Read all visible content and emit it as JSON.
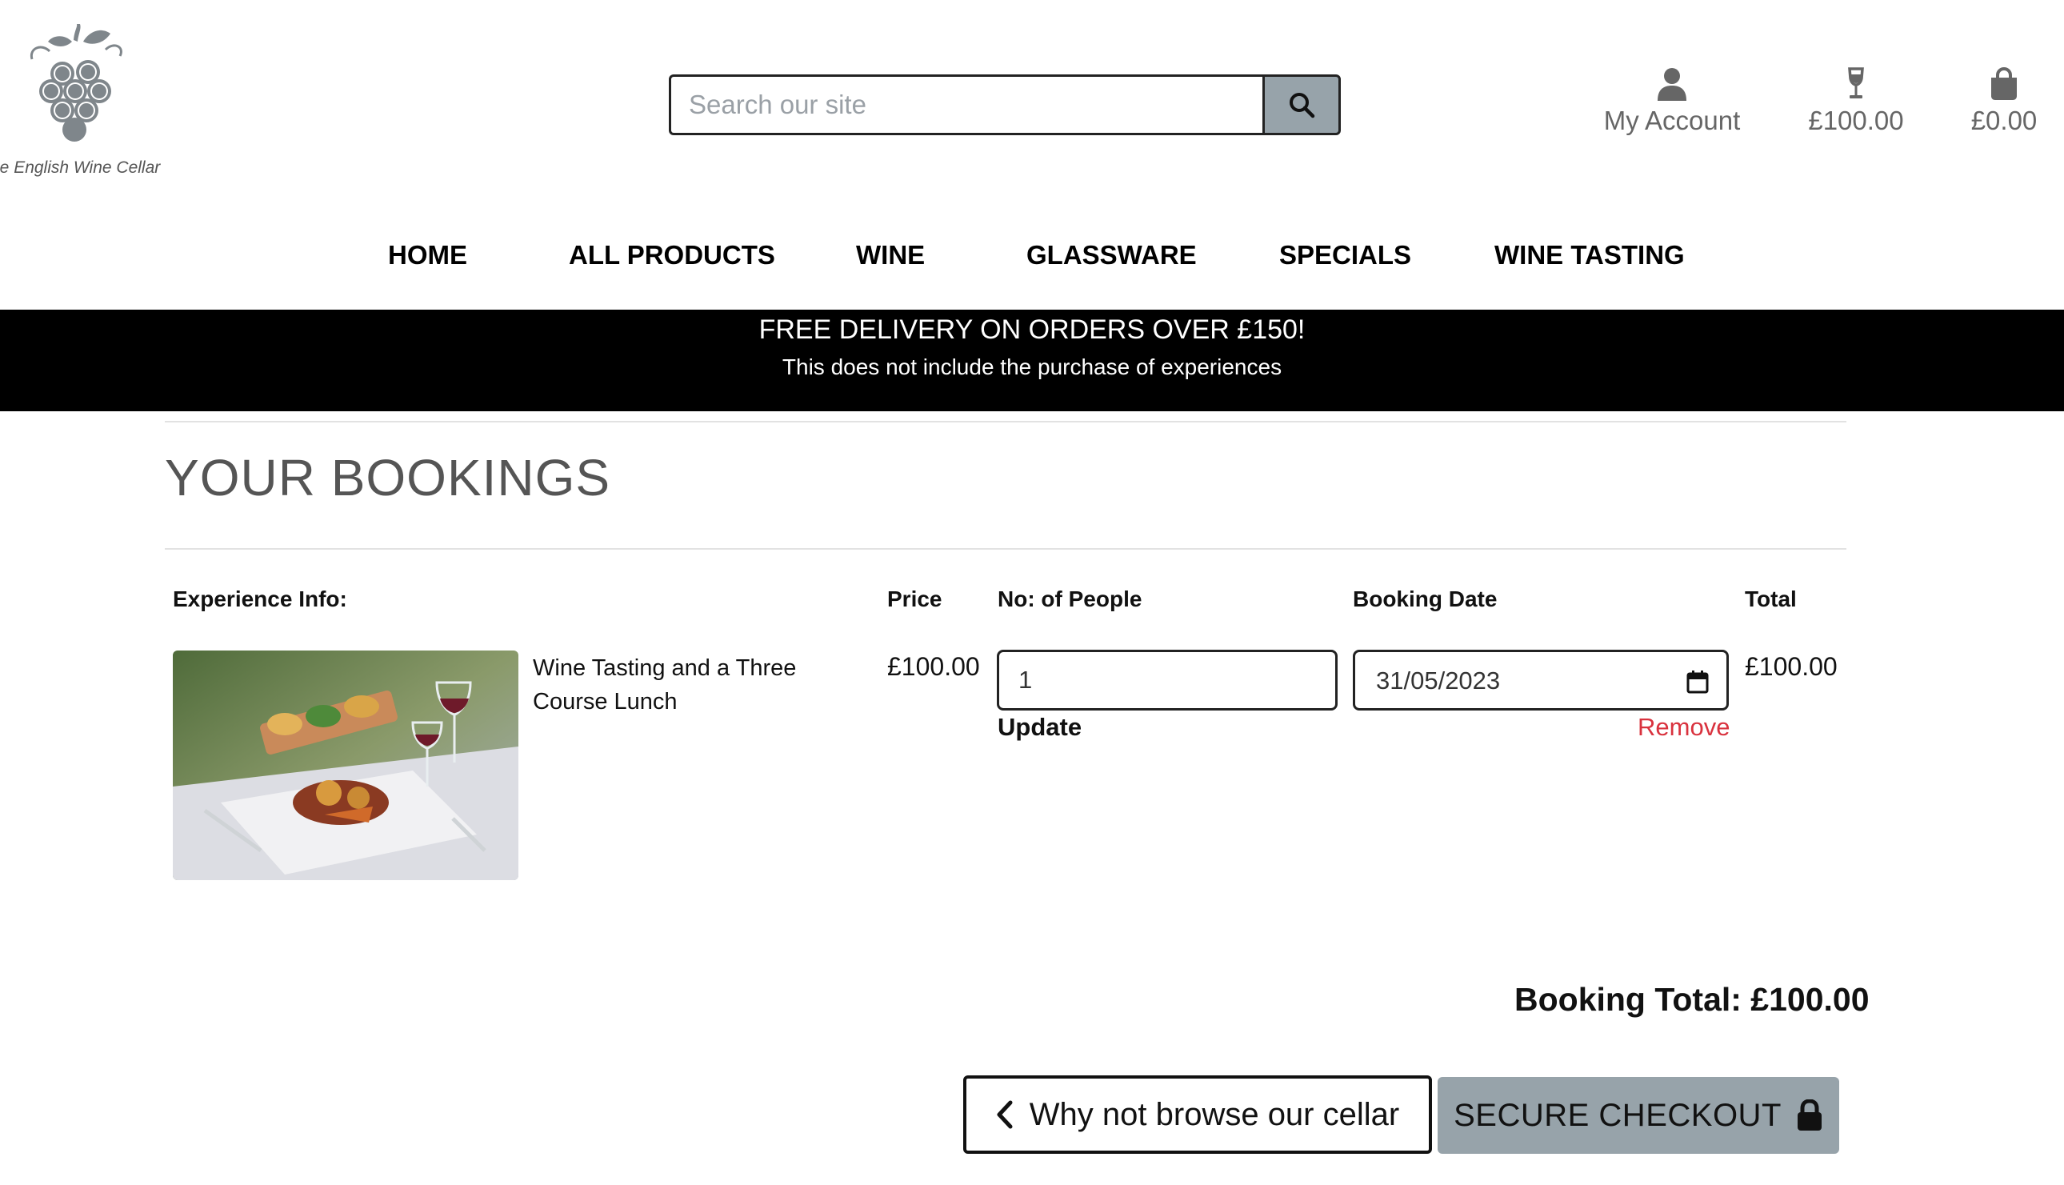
{
  "brand": {
    "logo_text": "he English Wine Cellar"
  },
  "search": {
    "placeholder": "Search our site"
  },
  "header": {
    "account_label": "My Account",
    "wine_total": "£100.00",
    "bag_total": "£0.00"
  },
  "nav": {
    "items": [
      "HOME",
      "ALL PRODUCTS",
      "WINE",
      "GLASSWARE",
      "SPECIALS",
      "WINE TASTING"
    ]
  },
  "banner": {
    "title": "FREE DELIVERY ON ORDERS OVER £150!",
    "subtitle": "This does not include the purchase of experiences"
  },
  "page": {
    "title": "YOUR BOOKINGS"
  },
  "table": {
    "headers": {
      "info": "Experience Info:",
      "price": "Price",
      "people": "No: of People",
      "date": "Booking Date",
      "total": "Total"
    },
    "rows": [
      {
        "name": "Wine Tasting and a Three Course Lunch",
        "price": "£100.00",
        "people": "1",
        "date": "31/05/2023",
        "total": "£100.00",
        "update_label": "Update",
        "remove_label": "Remove"
      }
    ]
  },
  "summary": {
    "booking_total": "Booking Total: £100.00"
  },
  "actions": {
    "browse_label": "Why not browse our cellar",
    "checkout_label": "SECURE CHECKOUT"
  },
  "colors": {
    "logo_grey": "#7f868b",
    "button_grey": "#97a3aa",
    "banner_bg": "#000000",
    "remove_red": "#d9323e"
  },
  "icons": {
    "logo": "grape-bunch-logo",
    "search": "search-icon",
    "account": "user-icon",
    "wine": "wine-glass-icon",
    "bag": "shopping-bag-icon",
    "calendar": "calendar-icon",
    "browse": "chevron-left-icon",
    "checkout": "lock-icon"
  }
}
